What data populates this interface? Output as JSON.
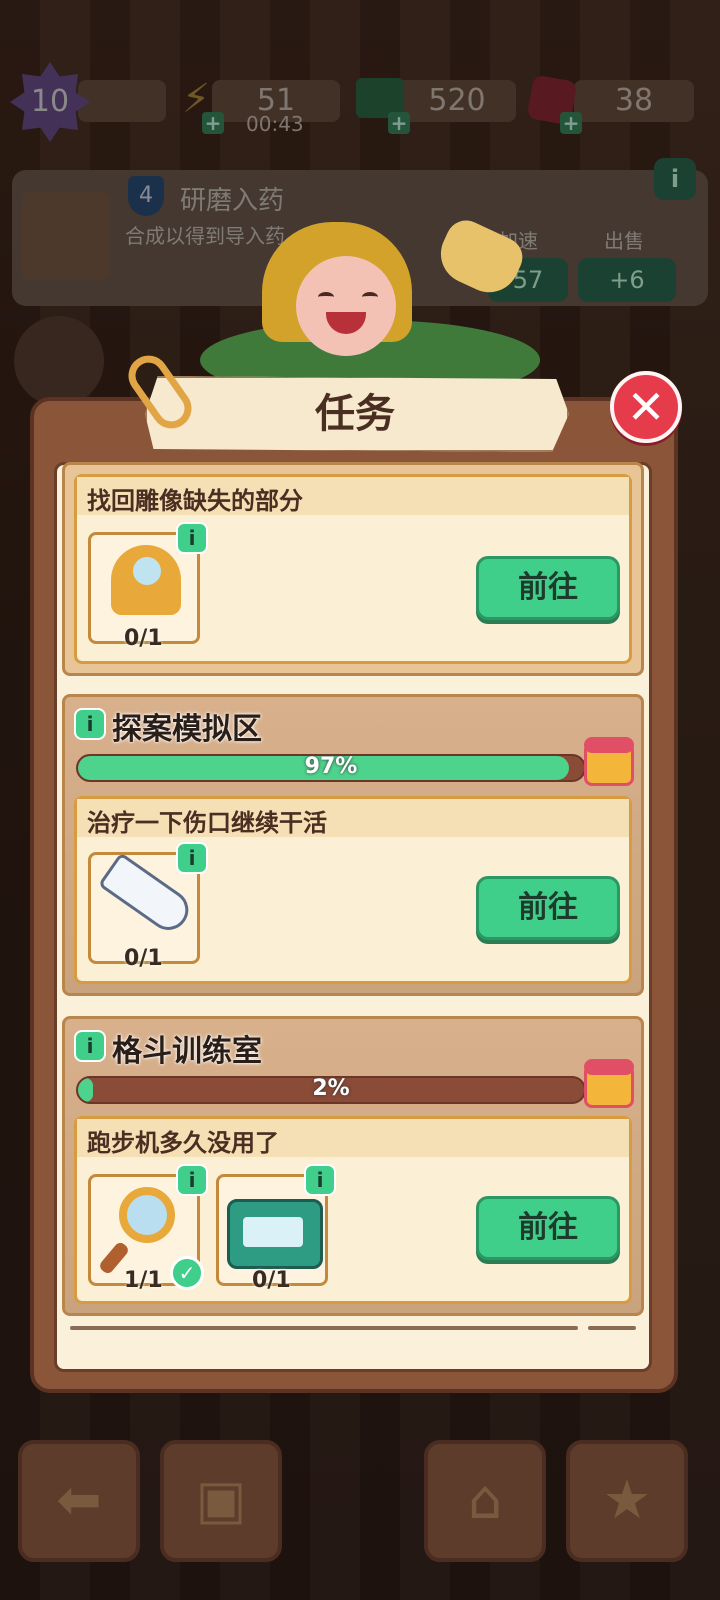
{
  "top_bar": {
    "level": "10",
    "energy": "51",
    "energy_timer": "00:43",
    "cash": "520",
    "gems": "38"
  },
  "hint_card": {
    "level_badge": "4",
    "title": "研磨入药",
    "subtitle": "合成以得到导入药",
    "speedup_label": "加速",
    "sell_label": "出售",
    "speedup_value": "57",
    "sell_value": "+6"
  },
  "panel": {
    "title": "任务",
    "close_icon": "close-x"
  },
  "tasks": [
    {
      "title": "找回雕像缺失的部分",
      "items": [
        {
          "icon": "telescope-icon",
          "count": "0/1"
        }
      ],
      "button": "前往"
    }
  ],
  "sections": [
    {
      "title": "探案模拟区",
      "progress_text": "97%",
      "progress": 0.97,
      "task": {
        "title": "治疗一下伤口继续干活",
        "items": [
          {
            "icon": "thermometer-icon",
            "count": "0/1"
          }
        ],
        "button": "前往"
      }
    },
    {
      "title": "格斗训练室",
      "progress_text": "2%",
      "progress": 0.02,
      "task": {
        "title": "跑步机多久没用了",
        "items": [
          {
            "icon": "magnifying-glass-icon",
            "count": "1/1",
            "done": true
          },
          {
            "icon": "forensic-kit-icon",
            "count": "0/1"
          }
        ],
        "button": "前往"
      }
    }
  ],
  "colors": {
    "accent_green": "#3fcf8a",
    "close_red": "#e63b4b",
    "panel_brown": "#8a5539"
  }
}
